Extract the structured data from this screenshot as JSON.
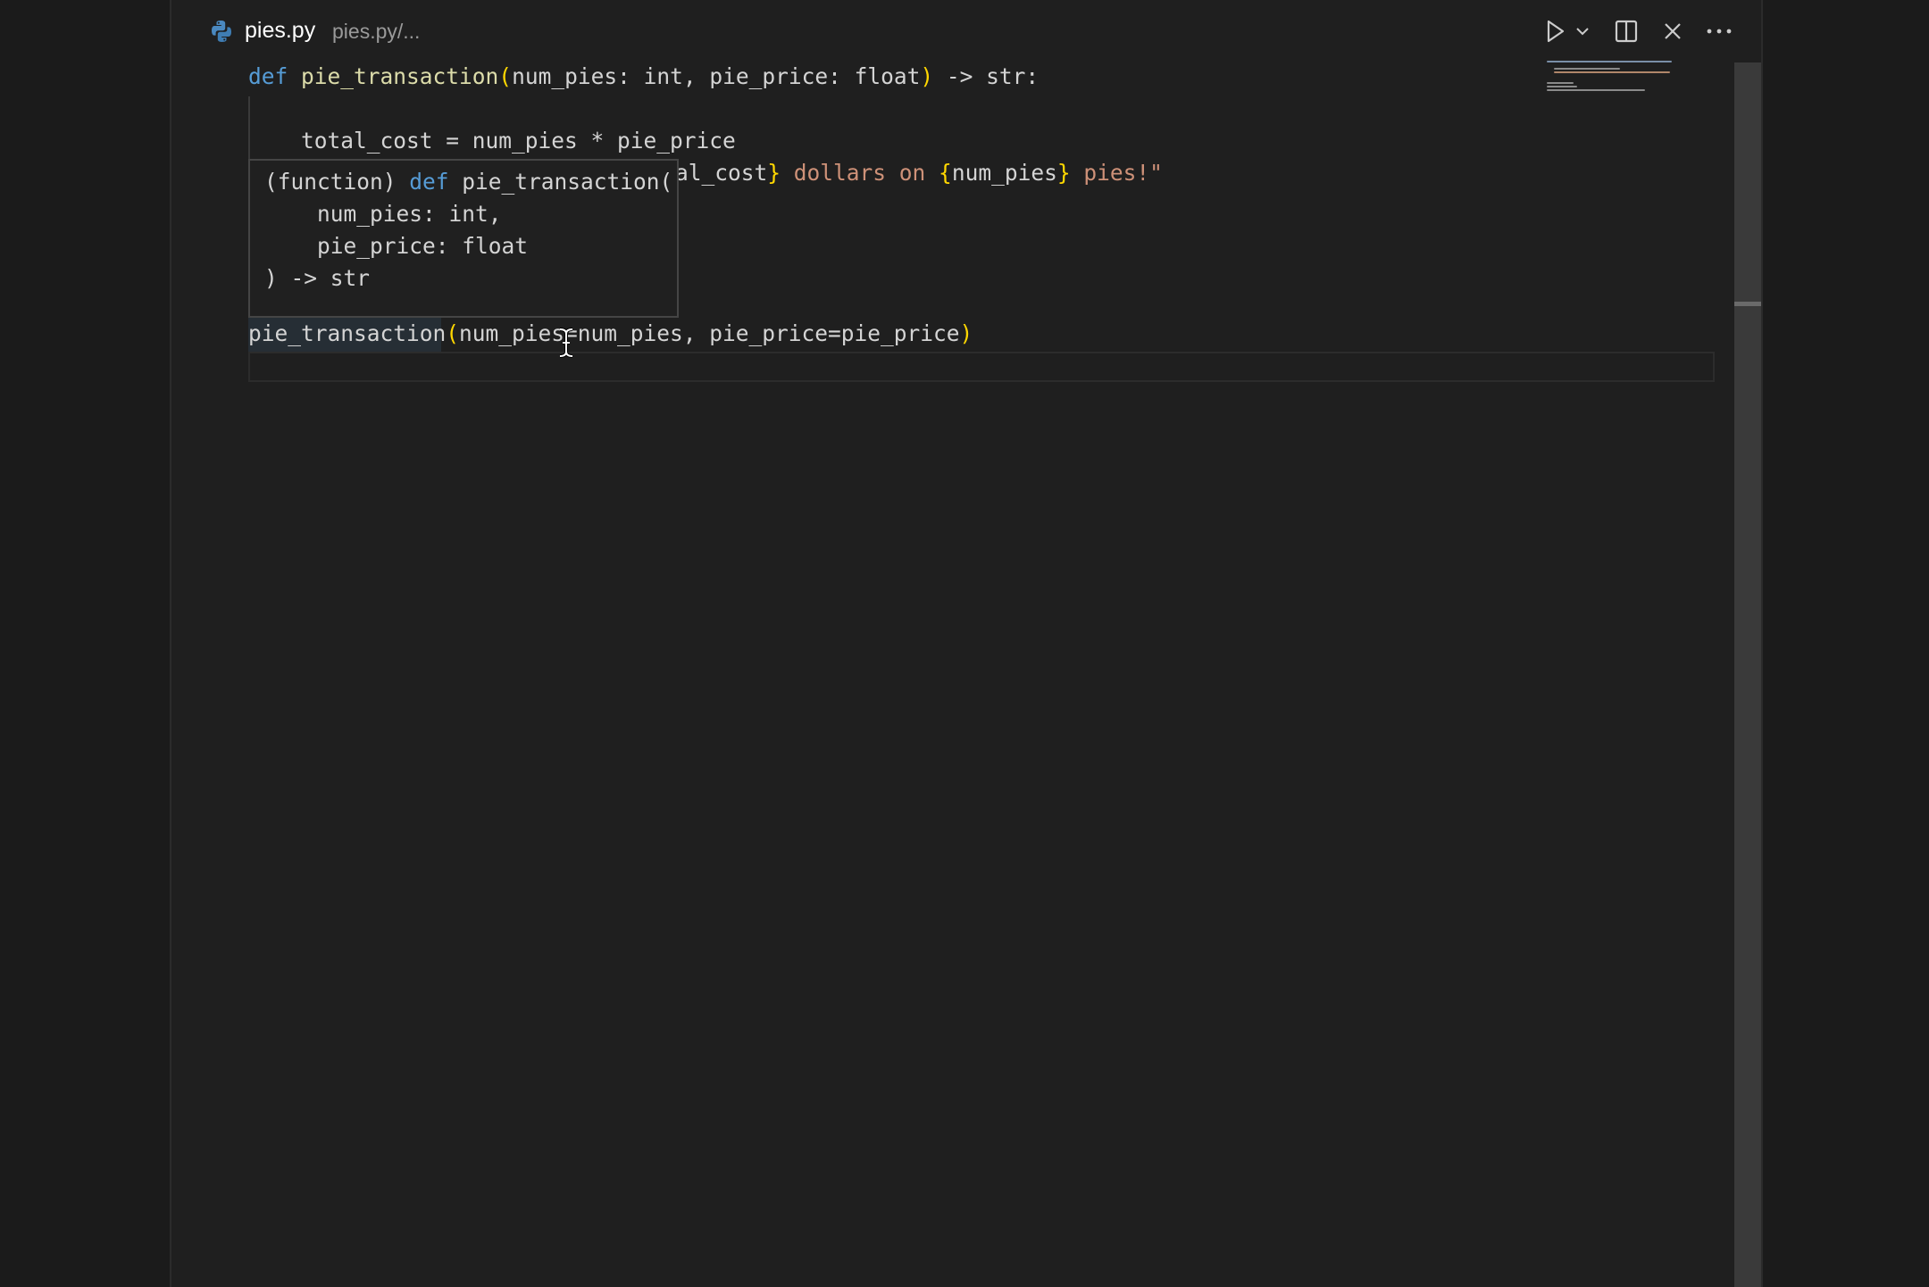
{
  "tab": {
    "title": "pies.py",
    "path": "pies.py/..."
  },
  "toolbar": {
    "run_icon": "play-icon",
    "run_dropdown_icon": "chevron-down-icon",
    "split_icon": "split-editor-icon",
    "close_icon": "close-icon",
    "more_icon": "ellipsis-icon"
  },
  "code": {
    "line1": {
      "kw": "def",
      "fn": "pie_transaction",
      "open": "(",
      "params": "num_pies: int, pie_price: float",
      "close": ")",
      "ret": " -> str:"
    },
    "line3": "    total_cost = num_pies * pie_price",
    "line4": {
      "visible": "al_cost",
      "br1": "}",
      "s1": " dollars on ",
      "br2": "{",
      "var": "num_pies",
      "br3": "}",
      "s2": " pies!\""
    },
    "line9": {
      "fn": "pie_transaction",
      "open": "(",
      "args": "num_pies=num_pies, pie_price=pie_price",
      "close": ")"
    }
  },
  "hover": {
    "l1_prefix": "(function) ",
    "l1_kw": "def",
    "l1_rest": " pie_transaction(",
    "l2": "    num_pies: int,",
    "l3": "    pie_price: float",
    "l4": ") -> str"
  },
  "colors": {
    "background": "#1f1f1f",
    "keyword": "#569cd6",
    "function": "#dcdcaa",
    "bracket": "#ffd700",
    "string": "#ce9178",
    "text": "#d4d4d4"
  }
}
